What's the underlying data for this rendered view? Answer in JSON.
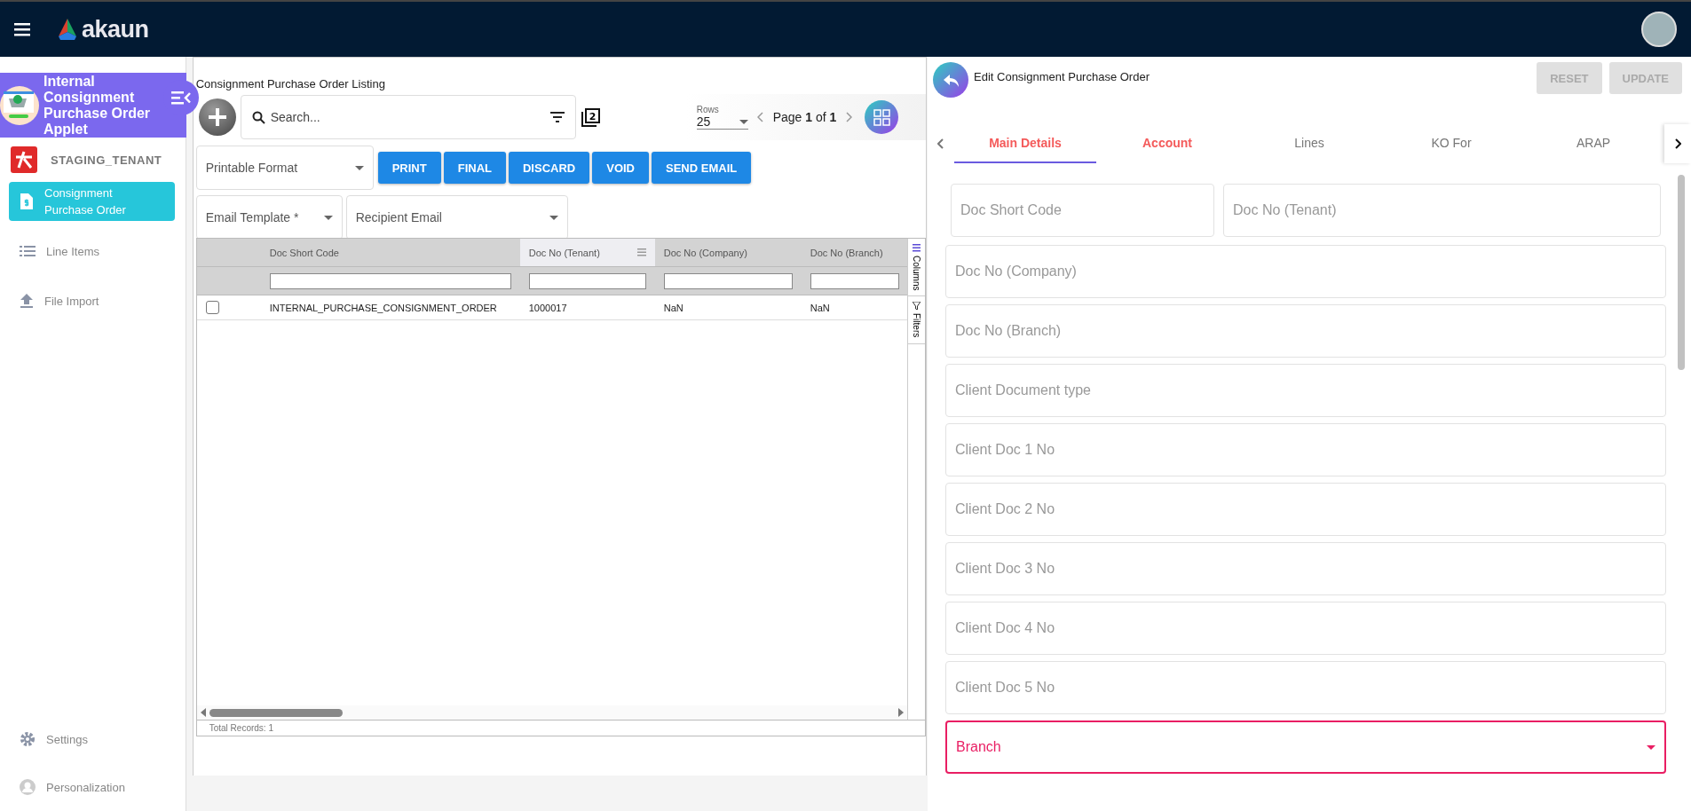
{
  "top_bar": {
    "brand": "akaun"
  },
  "sidebar": {
    "applet_title": "Internal Consignment Purchase Order Applet",
    "tenant": "STAGING_TENANT",
    "items": [
      {
        "label": "Consignment Purchase Order",
        "selected": true
      },
      {
        "label": "Line Items",
        "selected": false
      },
      {
        "label": "File Import",
        "selected": false
      }
    ],
    "bottom_items": [
      {
        "label": "Settings"
      },
      {
        "label": "Personalization"
      }
    ]
  },
  "listing": {
    "title": "Consignment Purchase Order Listing",
    "search": {
      "placeholder": "Search..."
    },
    "stack_count": "2",
    "rows_label": "Rows",
    "rows_value": "25",
    "page": "Page **1** of **1**",
    "printable_format": {
      "placeholder": "Printable Format"
    },
    "buttons": [
      "PRINT",
      "FINAL",
      "DISCARD",
      "VOID",
      "SEND EMAIL"
    ],
    "email_template": {
      "placeholder": "Email Template *"
    },
    "recipient_email": {
      "placeholder": "Recipient Email"
    },
    "table": {
      "columns": [
        {
          "label": "Doc Short Code",
          "highlighted": false
        },
        {
          "label": "Doc No (Tenant)",
          "highlighted": true
        },
        {
          "label": "Doc No (Company)",
          "highlighted": false
        },
        {
          "label": "Doc No (Branch)",
          "highlighted": false
        }
      ],
      "rows": [
        {
          "checked": false,
          "cells": [
            "INTERNAL_PURCHASE_CONSIGNMENT_ORDER",
            "1000017",
            "NaN",
            "NaN"
          ]
        }
      ],
      "side_tabs": [
        "Columns",
        "Filters"
      ],
      "footer": "Total Records: 1"
    }
  },
  "editor": {
    "title": "Edit Consignment Purchase Order",
    "buttons": [
      {
        "label": "RESET",
        "disabled": true
      },
      {
        "label": "UPDATE",
        "disabled": true
      }
    ],
    "tabs": [
      {
        "label": "Main Details",
        "selected": true,
        "error": true
      },
      {
        "label": "Account",
        "selected": false,
        "error": true
      },
      {
        "label": "Lines",
        "selected": false,
        "error": false
      },
      {
        "label": "KO For",
        "selected": false,
        "error": false
      },
      {
        "label": "ARAP",
        "selected": false,
        "error": false
      }
    ],
    "field_rows": [
      [
        {
          "placeholder": "Doc Short Code",
          "kind": "text",
          "error": false
        },
        {
          "placeholder": "Doc No (Tenant)",
          "kind": "text",
          "error": false
        }
      ],
      [
        {
          "placeholder": "Doc No (Company)",
          "kind": "text",
          "error": false
        }
      ],
      [
        {
          "placeholder": "Doc No (Branch)",
          "kind": "text",
          "error": false
        }
      ],
      [
        {
          "placeholder": "Client Document type",
          "kind": "text",
          "error": false
        }
      ],
      [
        {
          "placeholder": "Client Doc 1 No",
          "kind": "text",
          "error": false
        }
      ],
      [
        {
          "placeholder": "Client Doc 2 No",
          "kind": "text",
          "error": false
        }
      ],
      [
        {
          "placeholder": "Client Doc 3 No",
          "kind": "text",
          "error": false
        }
      ],
      [
        {
          "placeholder": "Client Doc 4 No",
          "kind": "text",
          "error": false
        }
      ],
      [
        {
          "placeholder": "Client Doc 5 No",
          "kind": "text",
          "error": false
        }
      ],
      [
        {
          "placeholder": "Branch",
          "kind": "select",
          "error": true
        }
      ]
    ]
  }
}
